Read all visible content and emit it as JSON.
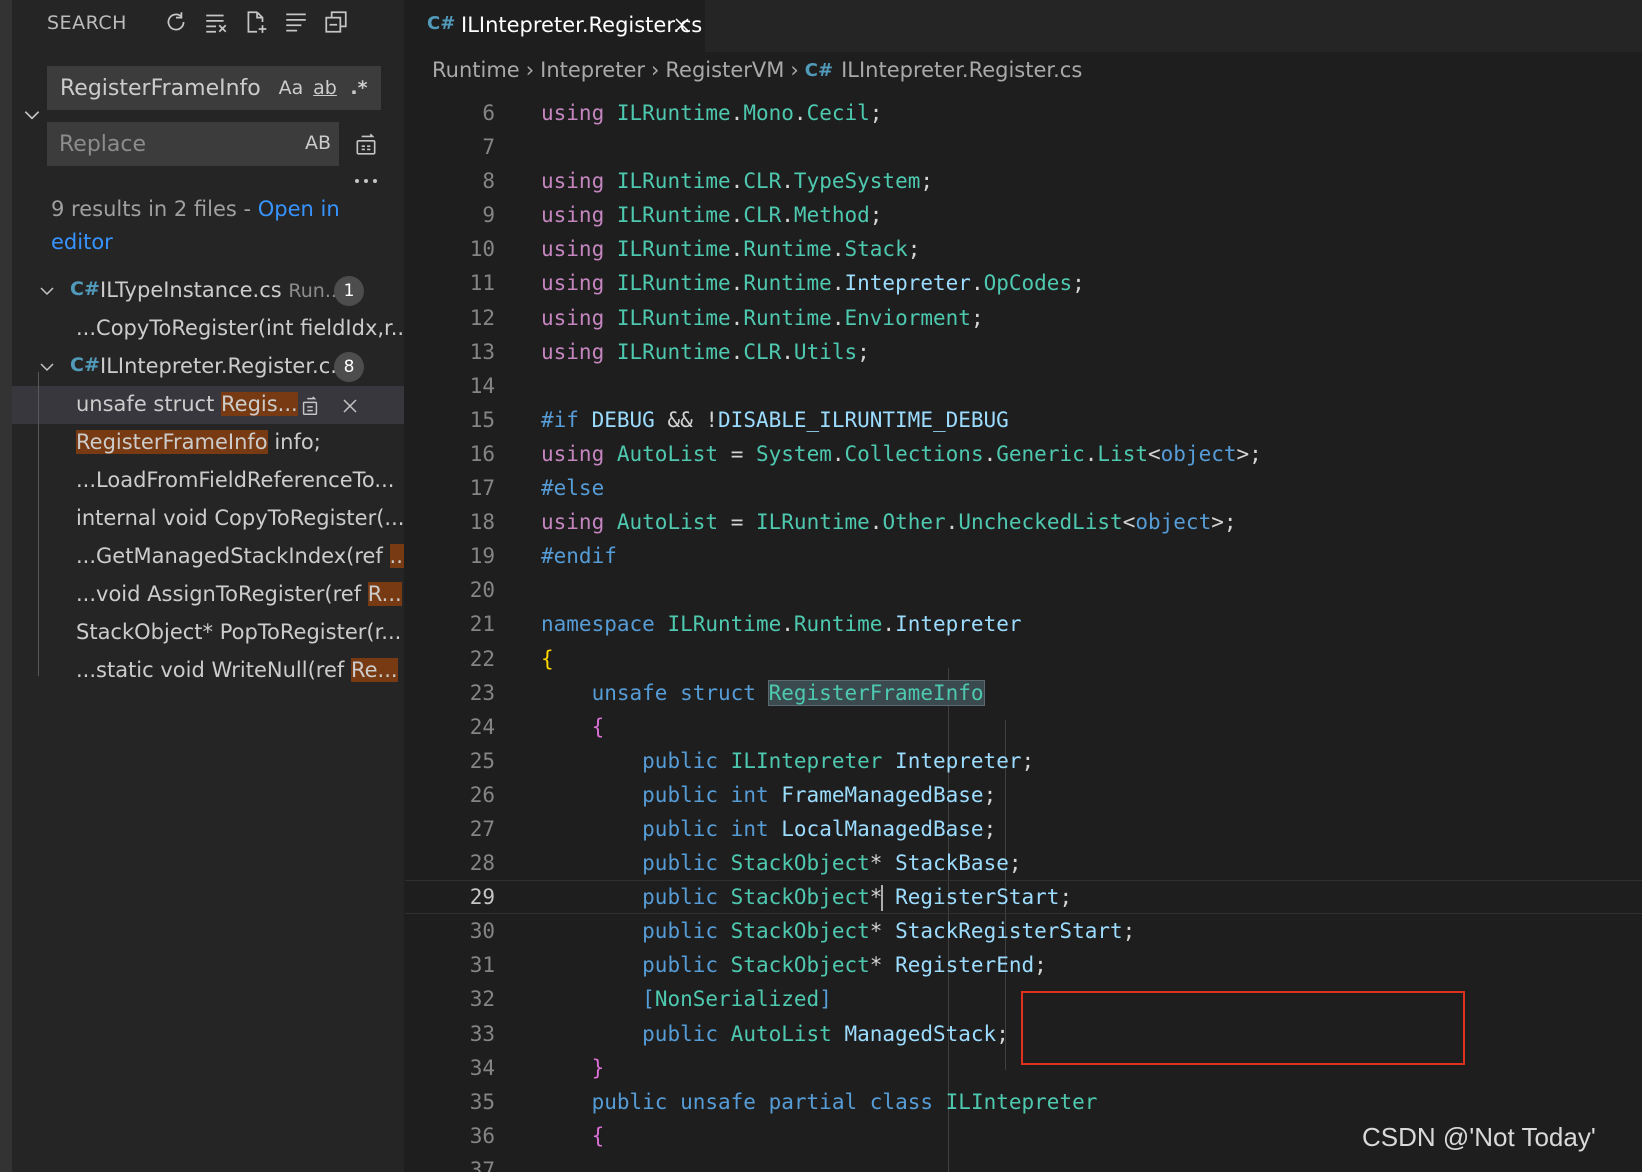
{
  "sidebar": {
    "title": "SEARCH",
    "actions": [
      {
        "icon": "refresh-icon"
      },
      {
        "icon": "clear-results-icon"
      },
      {
        "icon": "new-search-editor-icon"
      },
      {
        "icon": "view-as-tree-icon"
      },
      {
        "icon": "collapse-all-icon"
      }
    ],
    "search": {
      "value": "RegisterFrameInfo",
      "match_case": "Aa",
      "whole_word": "ab",
      "regex": ".*"
    },
    "replace": {
      "placeholder": "Replace",
      "preserve_case": "AB"
    },
    "summary": {
      "text": "9 results in 2 files - ",
      "link": "Open in editor"
    },
    "files": [
      {
        "name": "ILTypeInstance.cs",
        "path": "Run...",
        "count": "1",
        "matches": [
          {
            "before": "...CopyToRegister(int fieldIdx,r...",
            "hl": "",
            "after": ""
          }
        ]
      },
      {
        "name": "ILIntepreter.Register.c...",
        "path": "",
        "count": "8",
        "matches": [
          {
            "before": "unsafe struct ",
            "hl": "Regis...",
            "after": ""
          },
          {
            "before": "",
            "hl": "RegisterFrameInfo",
            "after": " info;"
          },
          {
            "before": "...LoadFromFieldReferenceTo...",
            "hl": "",
            "after": ""
          },
          {
            "before": "internal void CopyToRegister(...",
            "hl": "",
            "after": ""
          },
          {
            "before": "...GetManagedStackIndex(ref ",
            "hl": "...",
            "after": ""
          },
          {
            "before": "...void AssignToRegister(ref ",
            "hl": "R...",
            "after": ""
          },
          {
            "before": "StackObject* PopToRegister(r...",
            "hl": "",
            "after": ""
          },
          {
            "before": "...static void WriteNull(ref ",
            "hl": "Re...",
            "after": ""
          }
        ]
      }
    ]
  },
  "editor": {
    "tab": {
      "title": "ILIntepreter.Register.cs"
    },
    "breadcrumb": [
      "Runtime",
      "Intepreter",
      "RegisterVM",
      "ILIntepreter.Register.cs"
    ],
    "current_line": 29,
    "lines": [
      {
        "n": "6",
        "code": "using ILRuntime.Mono.Cecil;"
      },
      {
        "n": "7",
        "code": ""
      },
      {
        "n": "8",
        "code": "using ILRuntime.CLR.TypeSystem;"
      },
      {
        "n": "9",
        "code": "using ILRuntime.CLR.Method;"
      },
      {
        "n": "10",
        "code": "using ILRuntime.Runtime.Stack;"
      },
      {
        "n": "11",
        "code": "using ILRuntime.Runtime.Intepreter.OpCodes;"
      },
      {
        "n": "12",
        "code": "using ILRuntime.Runtime.Enviorment;"
      },
      {
        "n": "13",
        "code": "using ILRuntime.CLR.Utils;"
      },
      {
        "n": "14",
        "code": ""
      },
      {
        "n": "15",
        "code": "#if DEBUG && !DISABLE_ILRUNTIME_DEBUG"
      },
      {
        "n": "16",
        "code": "using AutoList = System.Collections.Generic.List<object>;"
      },
      {
        "n": "17",
        "code": "#else"
      },
      {
        "n": "18",
        "code": "using AutoList = ILRuntime.Other.UncheckedList<object>;"
      },
      {
        "n": "19",
        "code": "#endif"
      },
      {
        "n": "20",
        "code": ""
      },
      {
        "n": "21",
        "code": "namespace ILRuntime.Runtime.Intepreter"
      },
      {
        "n": "22",
        "code": "{"
      },
      {
        "n": "23",
        "code": "    unsafe struct RegisterFrameInfo"
      },
      {
        "n": "24",
        "code": "    {"
      },
      {
        "n": "25",
        "code": "        public ILIntepreter Intepreter;"
      },
      {
        "n": "26",
        "code": "        public int FrameManagedBase;"
      },
      {
        "n": "27",
        "code": "        public int LocalManagedBase;"
      },
      {
        "n": "28",
        "code": "        public StackObject* StackBase;"
      },
      {
        "n": "29",
        "code": "        public StackObject* RegisterStart;"
      },
      {
        "n": "30",
        "code": "        public StackObject* StackRegisterStart;"
      },
      {
        "n": "31",
        "code": "        public StackObject* RegisterEnd;"
      },
      {
        "n": "32",
        "code": "        [NonSerialized]"
      },
      {
        "n": "33",
        "code": "        public AutoList ManagedStack;"
      },
      {
        "n": "34",
        "code": "    }"
      },
      {
        "n": "35",
        "code": "    public unsafe partial class ILIntepreter"
      },
      {
        "n": "36",
        "code": "    {"
      },
      {
        "n": "37",
        "code": ""
      }
    ]
  },
  "watermark": "CSDN @'Not Today'",
  "colors": {
    "accent_link": "#3794ff",
    "match_highlight": "#783a12",
    "annotation_border": "#e0301e"
  }
}
